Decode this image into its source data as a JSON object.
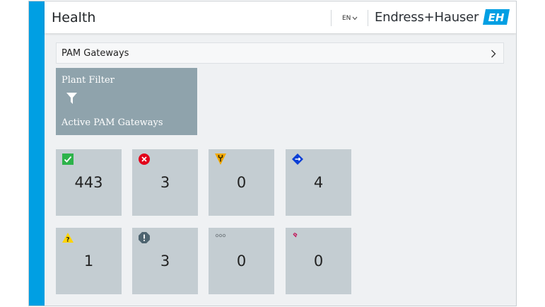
{
  "header": {
    "title": "Health",
    "language": "EN",
    "brand": "Endress+Hauser",
    "brand_logo_text": "EH"
  },
  "pam_gateways": {
    "label": "PAM Gateways"
  },
  "plant_filter": {
    "title": "Plant Filter",
    "subtitle": "Active PAM Gateways",
    "icon": "filter-icon"
  },
  "status_tiles": [
    {
      "status": "ok",
      "icon": "check-icon",
      "color": "#2db34a",
      "count": "443"
    },
    {
      "status": "failure",
      "icon": "error-circle-icon",
      "color": "#e2001a",
      "count": "3"
    },
    {
      "status": "maintenance-required",
      "icon": "wrench-icon",
      "color": "#f2a900",
      "count": "0"
    },
    {
      "status": "function-check",
      "icon": "diamond-icon",
      "color": "#0b3fd6",
      "count": "4"
    },
    {
      "status": "out-of-specification",
      "icon": "warning-triangle-icon",
      "color": "#ffd400",
      "count": "1"
    },
    {
      "status": "critical",
      "icon": "exclamation-octagon-icon",
      "color": "#4e6470",
      "count": "3"
    },
    {
      "status": "not-categorized",
      "icon": "dots-icon",
      "color": "#7a8288",
      "count": "0"
    },
    {
      "status": "disconnected",
      "icon": "link-broken-icon",
      "color": "#c2185b",
      "count": "0"
    }
  ]
}
